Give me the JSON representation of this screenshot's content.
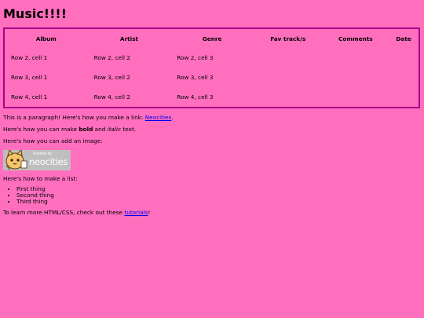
{
  "page": {
    "title": "Music!!!!"
  },
  "table": {
    "headers": [
      "Album",
      "Artist",
      "Genre",
      "Fav track/s",
      "Comments",
      "Date"
    ],
    "rows": [
      [
        "Row 2, cell 1",
        "Row 2, cell 2",
        "Row 2, cell 3",
        "",
        "",
        ""
      ],
      [
        "Row 3, cell 1",
        "Row 3, cell 2",
        "Row 3, cell 3",
        "",
        "",
        ""
      ],
      [
        "Row 4, cell 1",
        "Row 4, cell 2",
        "Row 4, cell 3",
        "",
        "",
        ""
      ]
    ]
  },
  "content": {
    "paragraph_prefix": "This is a paragraph! Here's how you make a link: ",
    "link_text": "Neocities",
    "paragraph_suffix": ".",
    "bold_prefix": "Here's how you can make ",
    "bold_word": "bold",
    "bold_mid": " and ",
    "italic_word": "italic",
    "bold_suffix": " text.",
    "image_intro": "Here's how you can add an image:",
    "badge_small": "hosted by",
    "badge_large": "neocities",
    "list_intro": "Here's how to make a list:",
    "list_items": [
      "First thing",
      "Second thing",
      "Third thing"
    ],
    "learn_prefix": "To learn more HTML/CSS, check out these ",
    "learn_link": "tutorials",
    "learn_suffix": "!"
  },
  "colors": {
    "background": "#ff6fbe",
    "table_border": "#a8008a",
    "link": "#0000ee",
    "badge_bg": "#bfbfbf"
  }
}
